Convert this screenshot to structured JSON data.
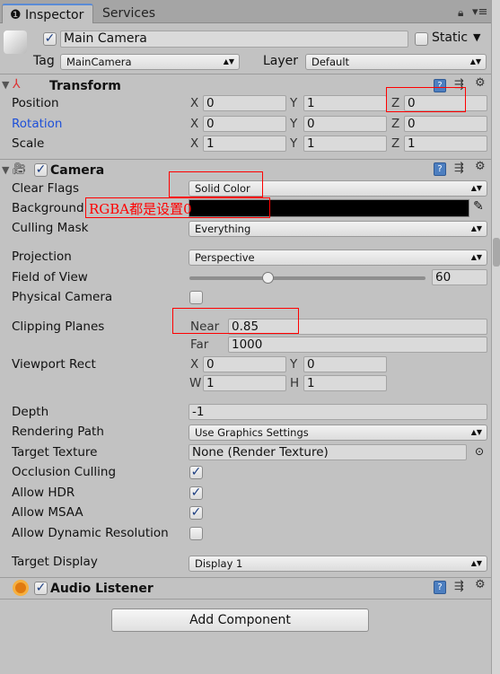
{
  "tabs": [
    {
      "label": "Inspector",
      "icon": "info-icon"
    },
    {
      "label": "Services"
    }
  ],
  "object": {
    "active": true,
    "name": "Main Camera",
    "static_label": "Static",
    "static": false,
    "tag_label": "Tag",
    "tag": "MainCamera",
    "layer_label": "Layer",
    "layer": "Default"
  },
  "transform": {
    "title": "Transform",
    "position": {
      "label": "Position",
      "x": "0",
      "y": "1",
      "z": "0"
    },
    "rotation": {
      "label": "Rotation",
      "x": "0",
      "y": "0",
      "z": "0"
    },
    "scale": {
      "label": "Scale",
      "x": "1",
      "y": "1",
      "z": "1"
    },
    "axes": {
      "x": "X",
      "y": "Y",
      "z": "Z",
      "w": "W",
      "h": "H"
    }
  },
  "camera": {
    "title": "Camera",
    "enabled": true,
    "clear_flags": {
      "label": "Clear Flags",
      "value": "Solid Color"
    },
    "background": {
      "label": "Background",
      "color": "#000000"
    },
    "annotation": "RGBA都是设置0",
    "culling_mask": {
      "label": "Culling Mask",
      "value": "Everything"
    },
    "projection": {
      "label": "Projection",
      "value": "Perspective"
    },
    "fov": {
      "label": "Field of View",
      "value": "60",
      "min": 1,
      "max": 179
    },
    "physical": {
      "label": "Physical Camera",
      "checked": false
    },
    "clipping": {
      "label": "Clipping Planes",
      "near_label": "Near",
      "near": "0.85",
      "far_label": "Far",
      "far": "1000"
    },
    "viewport": {
      "label": "Viewport Rect",
      "x": "0",
      "y": "0",
      "w": "1",
      "h": "1"
    },
    "depth": {
      "label": "Depth",
      "value": "-1"
    },
    "rendering_path": {
      "label": "Rendering Path",
      "value": "Use Graphics Settings"
    },
    "target_texture": {
      "label": "Target Texture",
      "value": "None (Render Texture)"
    },
    "occlusion": {
      "label": "Occlusion Culling",
      "checked": true
    },
    "hdr": {
      "label": "Allow HDR",
      "checked": true
    },
    "msaa": {
      "label": "Allow MSAA",
      "checked": true
    },
    "dynres": {
      "label": "Allow Dynamic Resolution",
      "checked": false
    },
    "target_display": {
      "label": "Target Display",
      "value": "Display 1"
    }
  },
  "audio": {
    "title": "Audio Listener",
    "enabled": true
  },
  "add_component": "Add Component",
  "colors": {
    "panel": "#c2c2c2",
    "rotation_label": "#1e50d8",
    "annotation": "#ff0000"
  }
}
